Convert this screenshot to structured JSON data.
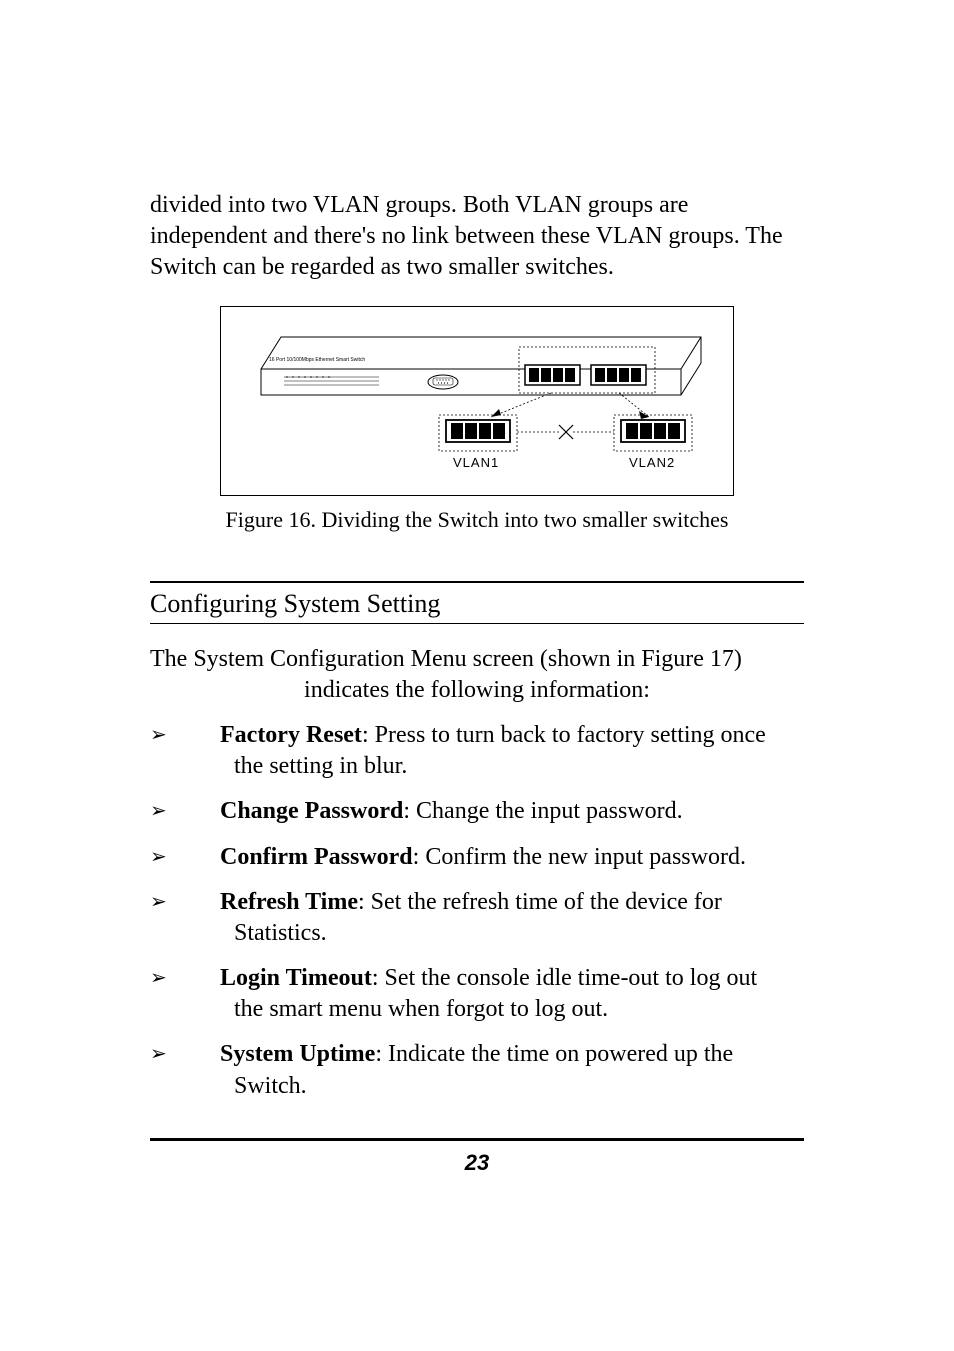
{
  "intro": "divided into two VLAN groups. Both VLAN groups are independent and there's no link between these VLAN groups. The Switch can be regarded as two smaller switches.",
  "figure": {
    "switch_label": "16 Port 10/100Mbps Ethernet Smart Switch",
    "vlan1": "VLAN1",
    "vlan2": "VLAN2",
    "caption": "Figure 16. Dividing the Switch into two smaller switches"
  },
  "section_heading": "Configuring System Setting",
  "para_line1": "The System Configuration Menu screen (shown in Figure 17)",
  "para_line2": "indicates the following information:",
  "bullets": [
    {
      "term": "Factory Reset",
      "desc_inline": ": Press to turn back to factory setting once",
      "desc_hang": "the setting in blur."
    },
    {
      "term": "Change Password",
      "desc_inline": ":  Change the input password.",
      "desc_hang": ""
    },
    {
      "term": "Confirm Password",
      "desc_inline": ": Confirm the new input password.",
      "desc_hang": ""
    },
    {
      "term": "Refresh Time",
      "desc_inline": ": Set the refresh time of the device for",
      "desc_hang": "Statistics."
    },
    {
      "term": "Login Timeout",
      "desc_inline": ": Set the console idle time-out to log out",
      "desc_hang": "the smart menu when forgot to log out."
    },
    {
      "term": "System Uptime",
      "desc_inline": ": Indicate the time on powered up the",
      "desc_hang": "Switch."
    }
  ],
  "bullet_glyph": "➢",
  "page_number": "23"
}
